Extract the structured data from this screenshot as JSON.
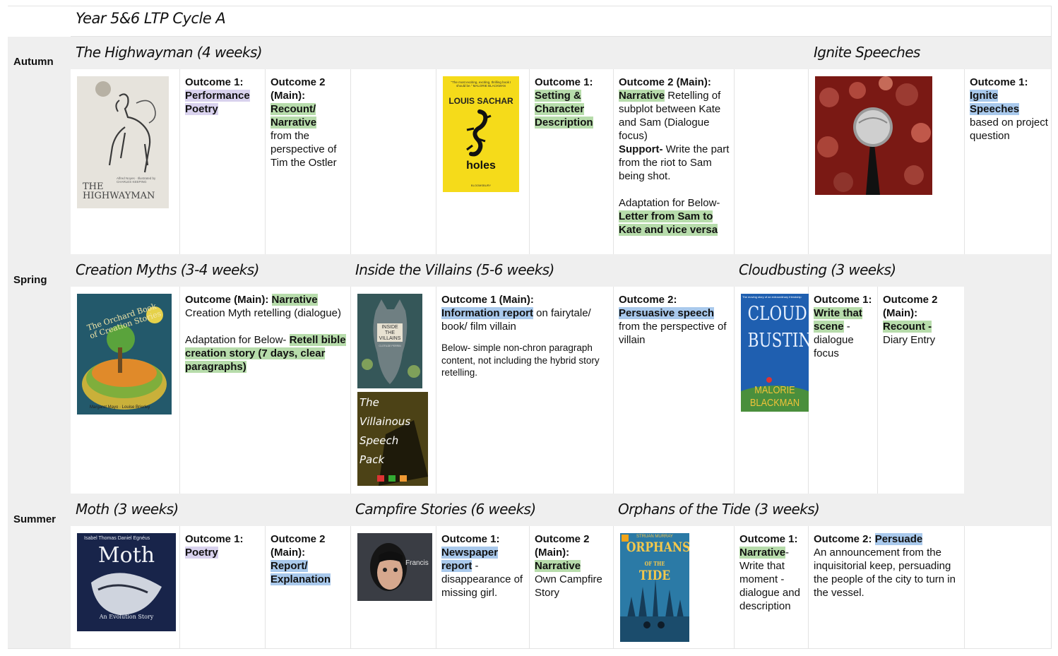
{
  "page": {
    "title": "Year 5&6 LTP Cycle A"
  },
  "seasons": {
    "autumn": "Autumn",
    "spring": "Spring",
    "summer": "Summer"
  },
  "units": {
    "highwayman": "The Highwayman (4 weeks)",
    "ignite": "Ignite Speeches",
    "creation": "Creation Myths (3-4 weeks)",
    "villains": "Inside the Villains (5-6 weeks)",
    "cloud": "Cloudbusting (3 weeks)",
    "moth": "Moth (3 weeks)",
    "campfire": "Campfire Stories (6 weeks)",
    "orphans": "Orphans of the Tide (3 weeks)"
  },
  "covers": {
    "highwayman": {
      "title": "THE HIGHWAYMAN",
      "sub": "Alfred Noyes · Illustrated by CHARLES KEEPING"
    },
    "holes": {
      "quote": "\"The most exciting, exciting, thrilling book I should be.\" MALORIE BLACKMAN",
      "author": "LOUIS SACHAR",
      "title": "holes",
      "publisher": "BLOOMSBURY"
    },
    "creation": {
      "title": "The Orchard Book of Creation Stories",
      "authors": "Margaret Mayo · Louise Brierley"
    },
    "villains": {
      "title": "INSIDE THE VILLAINS",
      "author": "CLOTILDE PERRIN"
    },
    "speech_pack": {
      "l1": "The",
      "l2": "Villainous",
      "l3": "Speech",
      "l4": "Pack"
    },
    "cloud": {
      "tag": "The moving story of an extraordinary friendship",
      "l1": "CLOUD",
      "l2": "BUSTING",
      "a1": "MALORIE",
      "a2": "BLACKMAN"
    },
    "moth": {
      "authors": "Isabel Thomas   Daniel Egnéus",
      "title": "Moth",
      "sub": "An Evolution Story"
    },
    "francis": {
      "name": "Francis"
    },
    "orphans": {
      "author": "STRUAN MURRAY",
      "l1": "ORPHANS",
      "l2": "OF THE",
      "l3": "TIDE"
    }
  },
  "autumn": {
    "a1": {
      "label": "Outcome 1:",
      "hl": "Performance Poetry"
    },
    "a2": {
      "label": "Outcome 2 (Main):",
      "hl": "Recount/ Narrative",
      "rest": "from the perspective of Tim the Ostler"
    },
    "h1": {
      "label": "Outcome 1:",
      "hl": "Setting & Character Description"
    },
    "h2": {
      "label": "Outcome 2 (Main):",
      "hl": "Narrative",
      "rest": " Retelling of subplot between Kate and Sam (Dialogue focus)",
      "support_label": "Support-",
      "support": " Write the part from the riot to Sam being shot.",
      "adapt": "Adaptation for Below-",
      "adapt_hl": "Letter from Sam to Kate and vice versa"
    },
    "i1": {
      "label": "Outcome 1:",
      "hl": "Ignite Speeches",
      "rest": "based on project question"
    }
  },
  "spring": {
    "c1": {
      "label": "Outcome (Main):",
      "hl": "Narrative",
      "rest": "Creation Myth retelling (dialogue)",
      "adapt": "Adaptation for Below-",
      "adapt_hl": "Retell bible creation story (7 days, clear paragraphs)"
    },
    "v1": {
      "label": "Outcome 1 (Main):",
      "hl": "Information report",
      "rest": " on fairytale/ book/ film villain",
      "below": "Below- simple non-chron paragraph content, not including the hybrid story retelling."
    },
    "v2": {
      "label": "Outcome 2:",
      "hl": "Persuasive speech",
      "rest": "from the perspective of villain"
    },
    "cb1": {
      "label": "Outcome 1:",
      "hl": "Write that scene",
      "rest": "- dialogue focus"
    },
    "cb2": {
      "label": "Outcome 2 (Main):",
      "hl": "Recount -",
      "rest": "Diary Entry"
    }
  },
  "summer": {
    "m1": {
      "label": "Outcome 1:",
      "hl": "Poetry"
    },
    "m2": {
      "label": "Outcome 2 (Main):",
      "hl": "Report/ Explanation"
    },
    "cs1": {
      "label": "Outcome 1:",
      "hl": "Newspaper report",
      "rest": "- disappearance of missing girl."
    },
    "cs2": {
      "label": "Outcome 2 (Main):",
      "hl": "Narrative",
      "rest": "Own Campfire Story"
    },
    "o1": {
      "label": "Outcome 1:",
      "hl": "Narrative",
      "rest": "- Write that moment - dialogue and description"
    },
    "o2": {
      "label": "Outcome 2:",
      "hl": "Persuade",
      "rest": "An announcement from the inquisitorial keep, persuading the people of the city to turn in the vessel."
    }
  },
  "colors": {
    "band": "#efefef",
    "green_highlight": "#b7dcab",
    "blue_highlight": "#a9c9ec",
    "purple_highlight": "#d9d2ee"
  }
}
